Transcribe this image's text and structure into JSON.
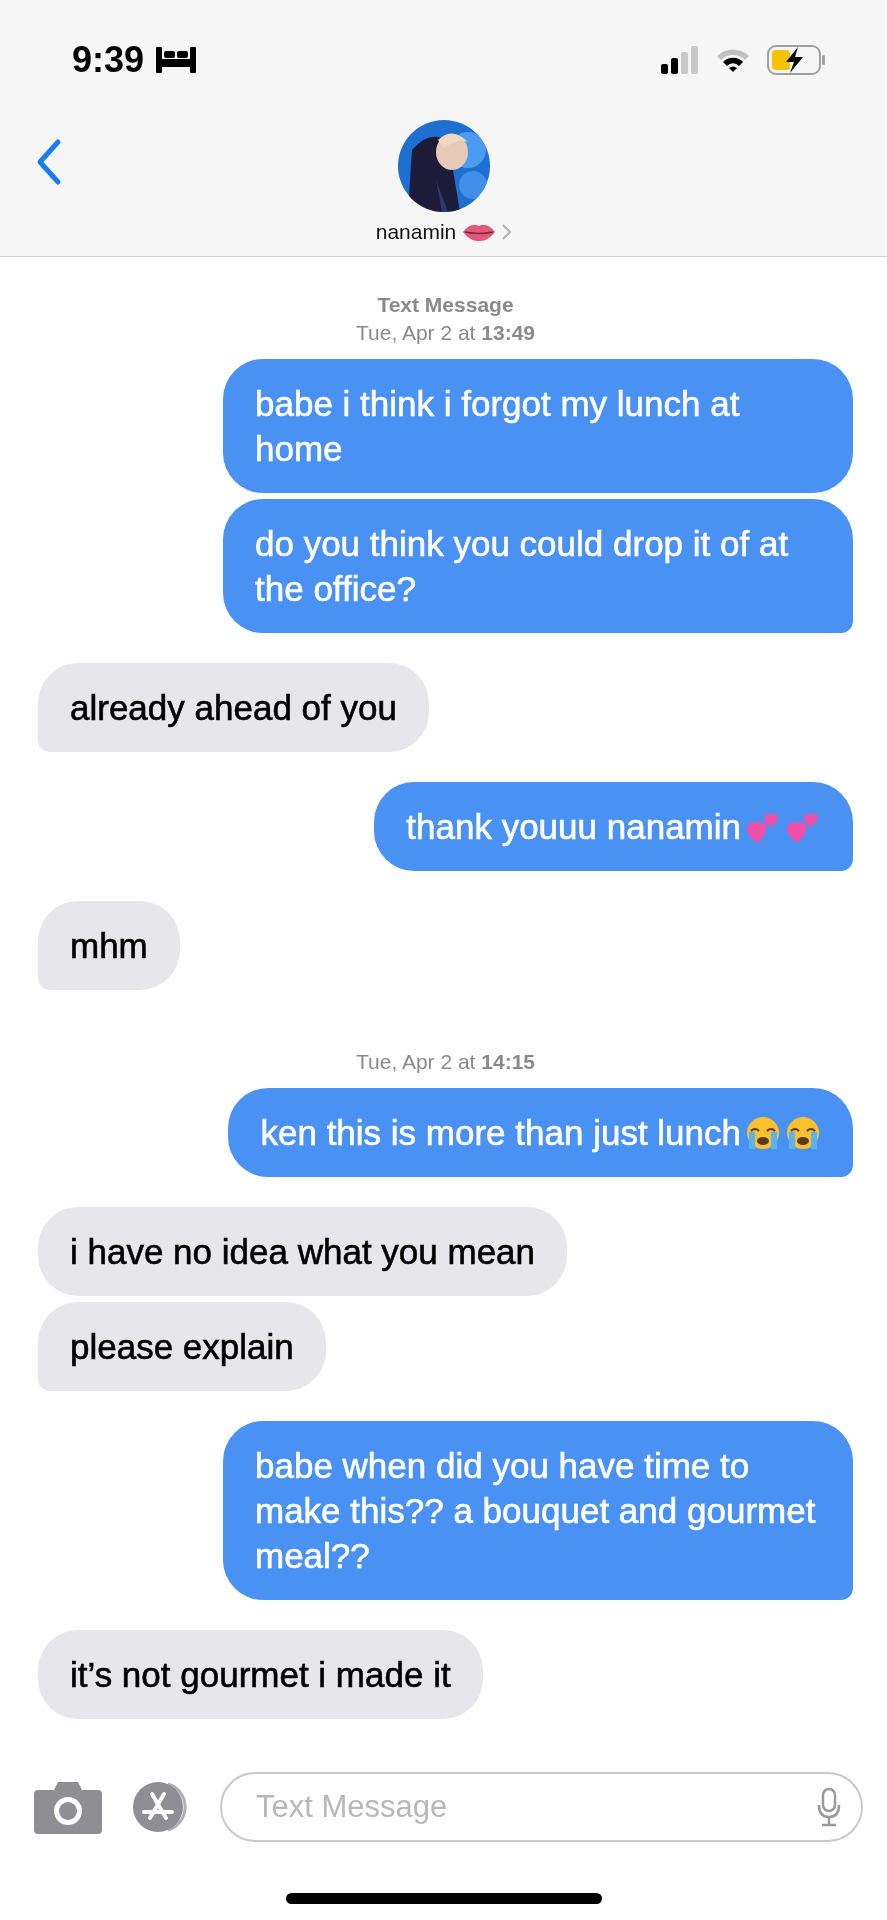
{
  "status_bar": {
    "time": "9:39"
  },
  "contact": {
    "name": "nanamin",
    "emoji": [
      {
        "kind": "lips"
      }
    ]
  },
  "messages": [
    {
      "kind": "timestamp",
      "label": "Text Message",
      "time": "Tue, Apr 2 at **13:49**"
    },
    {
      "kind": "sent",
      "text": "babe i think i forgot my lunch at home",
      "tail": false
    },
    {
      "kind": "sent",
      "text": "do you think you could drop it of at the office?",
      "tail": true
    },
    {
      "kind": "received",
      "text": "already ahead of you",
      "tail": true
    },
    {
      "kind": "sent",
      "text": "thank youuu nanamin",
      "emoji": [
        {
          "kind": "hearts"
        },
        {
          "kind": "hearts"
        }
      ],
      "tail": true
    },
    {
      "kind": "received",
      "text": "mhm",
      "tail": true
    },
    {
      "kind": "timestamp",
      "time": "Tue, Apr 2 at **14:15**"
    },
    {
      "kind": "sent",
      "text": "ken this is more than just lunch",
      "emoji": [
        {
          "kind": "crying"
        },
        {
          "kind": "crying"
        }
      ],
      "tail": true
    },
    {
      "kind": "received",
      "text": "i have no idea what you mean",
      "tail": false
    },
    {
      "kind": "received",
      "text": "please explain",
      "tail": true
    },
    {
      "kind": "sent",
      "text": "babe when did you have time to make this?? a bouquet and gourmet meal??",
      "tail": true
    },
    {
      "kind": "received",
      "text": "it’s not gourmet i made it",
      "tail": false
    }
  ],
  "compose": {
    "placeholder": "Text Message"
  }
}
